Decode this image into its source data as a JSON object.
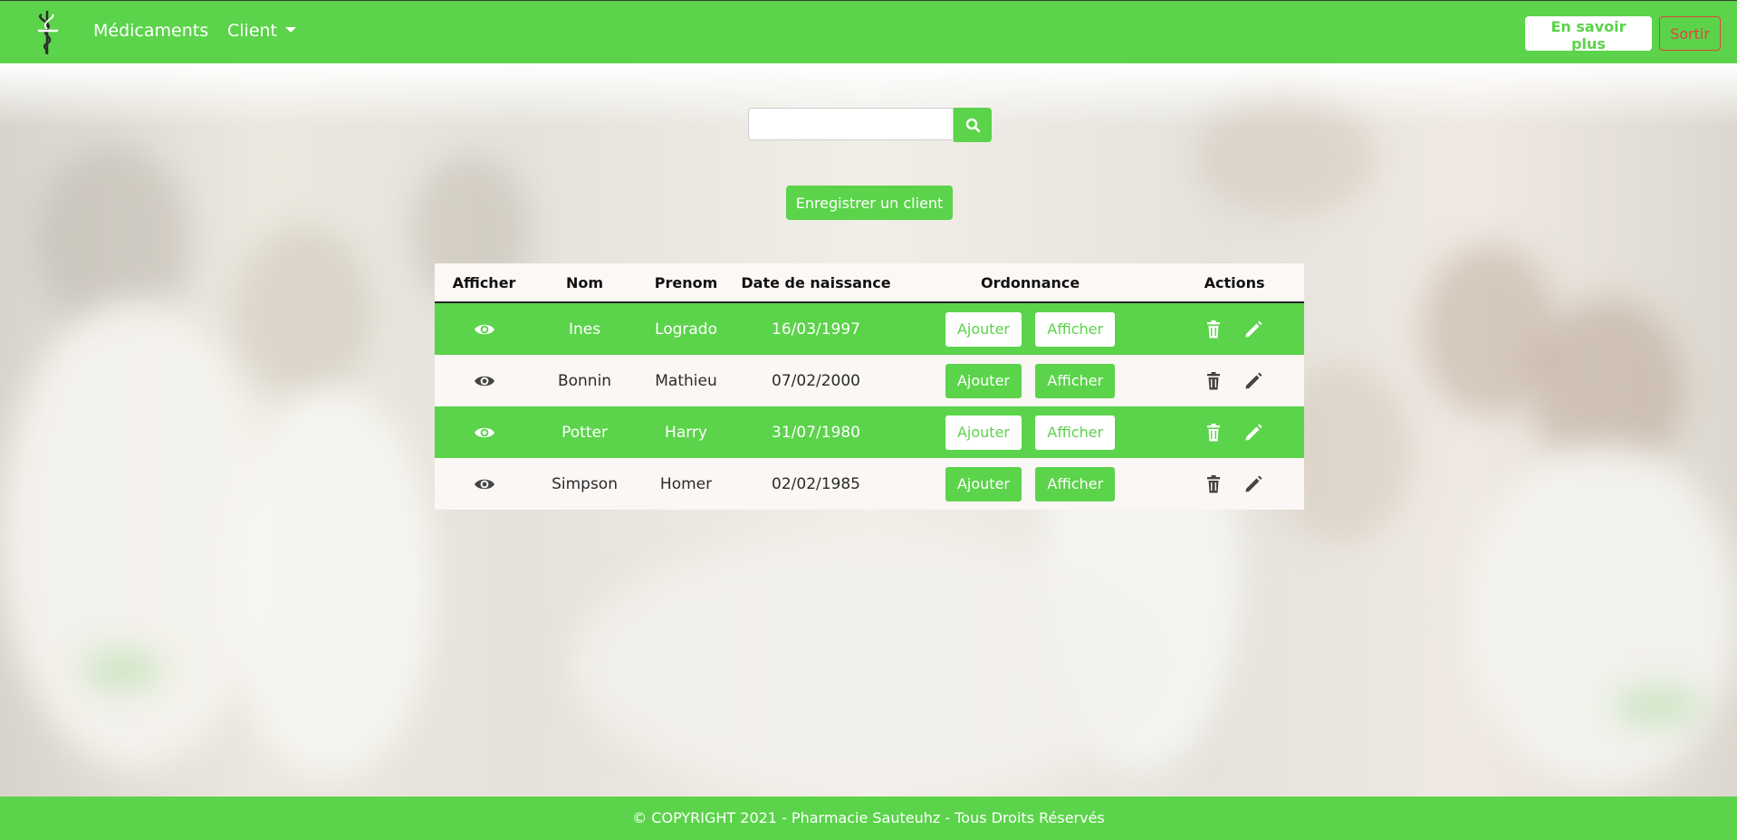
{
  "navbar": {
    "logo_icon": "caduceus-icon",
    "links": [
      {
        "label": "Médicaments"
      },
      {
        "label": "Client"
      }
    ],
    "learn_more_label": "En savoir plus",
    "logout_label": "Sortir"
  },
  "search": {
    "placeholder": "",
    "value": "",
    "button_icon": "search-icon"
  },
  "register_button_label": "Enregistrer un client",
  "table": {
    "headers": [
      "Afficher",
      "Nom",
      "Prenom",
      "Date de naissance",
      "Ordonnance",
      "Actions"
    ],
    "rows": [
      {
        "nom": "Ines",
        "prenom": "Logrado",
        "date": "16/03/1997",
        "add_label": "Ajouter",
        "show_label": "Afficher"
      },
      {
        "nom": "Bonnin",
        "prenom": "Mathieu",
        "date": "07/02/2000",
        "add_label": "Ajouter",
        "show_label": "Afficher"
      },
      {
        "nom": "Potter",
        "prenom": "Harry",
        "date": "31/07/1980",
        "add_label": "Ajouter",
        "show_label": "Afficher"
      },
      {
        "nom": "Simpson",
        "prenom": "Homer",
        "date": "02/02/1985",
        "add_label": "Ajouter",
        "show_label": "Afficher"
      }
    ],
    "row_icons": [
      "eye-icon",
      "trash-icon",
      "pencil-icon"
    ]
  },
  "footer": {
    "text": "© COPYRIGHT 2021 - Pharmacie Sauteuhz - Tous Droits Réservés"
  },
  "colors": {
    "accent": "#5bd34a",
    "danger": "#e0463d",
    "row_light": "#fbf7f4"
  }
}
